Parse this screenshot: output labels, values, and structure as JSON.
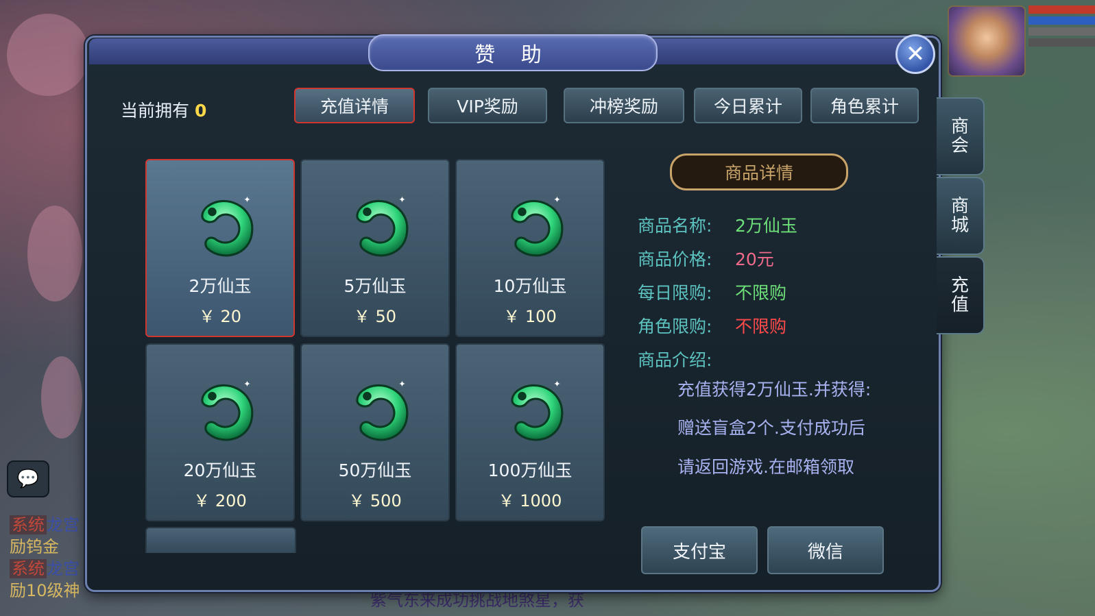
{
  "dialog": {
    "title": "赞 助",
    "owned_label": "当前拥有",
    "owned_value": "0"
  },
  "tabs": [
    {
      "label": "充值详情",
      "active": true
    },
    {
      "label": "VIP奖励",
      "active": false
    },
    {
      "label": "冲榜奖励",
      "active": false
    },
    {
      "label": "今日累计",
      "active": false
    },
    {
      "label": "角色累计",
      "active": false
    }
  ],
  "products": [
    {
      "name": "2万仙玉",
      "price": "￥ 20",
      "selected": true
    },
    {
      "name": "5万仙玉",
      "price": "￥ 50"
    },
    {
      "name": "10万仙玉",
      "price": "￥ 100"
    },
    {
      "name": "20万仙玉",
      "price": "￥ 200"
    },
    {
      "name": "50万仙玉",
      "price": "￥ 500"
    },
    {
      "name": "100万仙玉",
      "price": "￥ 1000"
    }
  ],
  "details": {
    "header": "商品详情",
    "name_label": "商品名称:",
    "name_value": "2万仙玉",
    "price_label": "商品价格:",
    "price_value": "20元",
    "daily_label": "每日限购:",
    "daily_value": "不限购",
    "role_label": "角色限购:",
    "role_value": "不限购",
    "intro_label": "商品介绍:",
    "intro_lines": [
      "充值获得2万仙玉.并获得:",
      "赠送盲盒2个.支付成功后",
      "请返回游戏.在邮箱领取"
    ]
  },
  "payment": {
    "alipay": "支付宝",
    "wechat": "微信"
  },
  "side_tabs": [
    {
      "label": "商会",
      "active": false
    },
    {
      "label": "商城",
      "active": false
    },
    {
      "label": "充值",
      "active": true
    }
  ],
  "chat": {
    "line1_tag": "系统",
    "line1_text": "龙宫",
    "line2_text": "励钨金",
    "line3_tag": "系统",
    "line3_text": "龙宫",
    "line4_text": "励10级神",
    "bottom_text": "紫气东来成功挑战地煞星，获"
  },
  "colors": {
    "accent_red": "#d0352e",
    "label_teal": "#5cc3c0",
    "value_green": "#6ee07a",
    "value_pink": "#f06a8a",
    "value_red": "#ff4a4a",
    "desc_purple": "#a8b2f0",
    "gold": "#c8a46a"
  }
}
